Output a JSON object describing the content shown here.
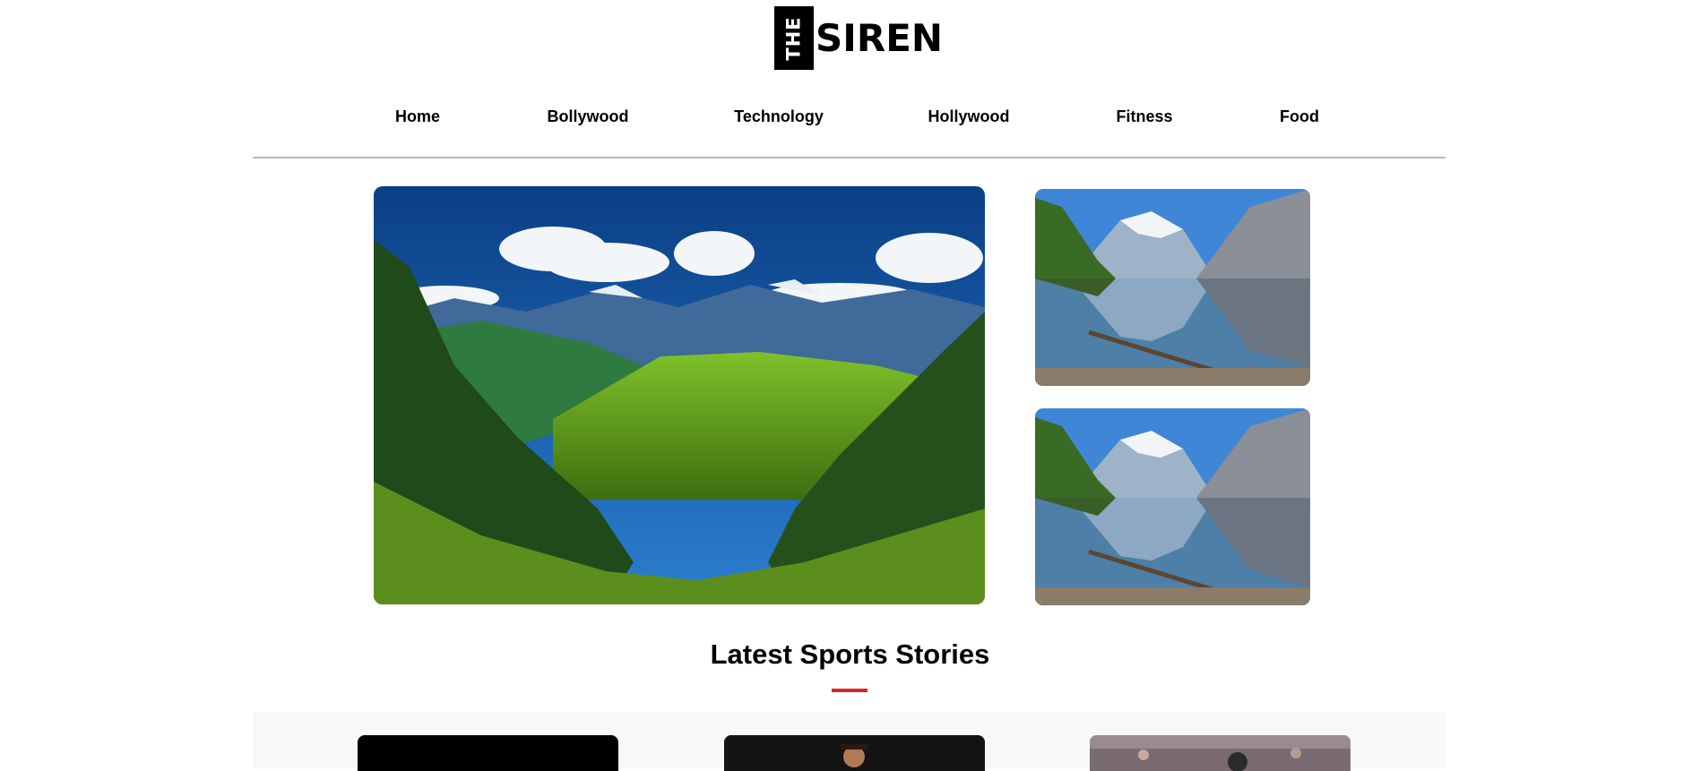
{
  "brand": {
    "prefix": "THE",
    "name": "SIREN"
  },
  "nav": {
    "items": [
      {
        "label": "Home"
      },
      {
        "label": "Bollywood"
      },
      {
        "label": "Technology"
      },
      {
        "label": "Hollywood"
      },
      {
        "label": "Fitness"
      },
      {
        "label": "Food"
      }
    ]
  },
  "featured": {
    "main_image": "mountain-valley-landscape",
    "side_images": [
      "mountain-lake-reflection",
      "mountain-lake-reflection"
    ]
  },
  "sports": {
    "heading": "Latest Sports Stories",
    "accent_color": "#d42a2a",
    "cards": [
      {
        "image": "dark-sports-photo"
      },
      {
        "image": "sports-player-photo"
      },
      {
        "image": "sports-crowd-photo"
      }
    ]
  }
}
